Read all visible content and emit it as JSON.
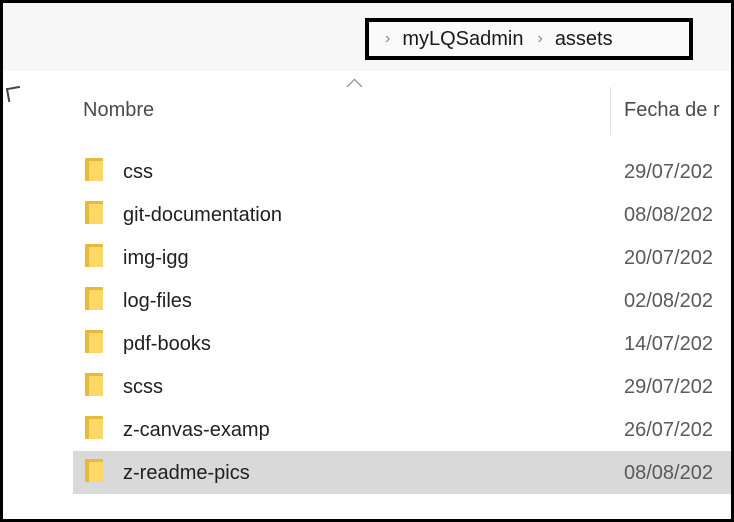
{
  "breadcrumb": {
    "items": [
      "myLQSadmin",
      "assets"
    ]
  },
  "columns": {
    "name": "Nombre",
    "date": "Fecha de r"
  },
  "rows": [
    {
      "name": "css",
      "date": "29/07/202",
      "selected": false
    },
    {
      "name": "git-documentation",
      "date": "08/08/202",
      "selected": false
    },
    {
      "name": "img-igg",
      "date": "20/07/202",
      "selected": false
    },
    {
      "name": "log-files",
      "date": "02/08/202",
      "selected": false
    },
    {
      "name": "pdf-books",
      "date": "14/07/202",
      "selected": false
    },
    {
      "name": "scss",
      "date": "29/07/202",
      "selected": false
    },
    {
      "name": "z-canvas-examp",
      "date": "26/07/202",
      "selected": false
    },
    {
      "name": "z-readme-pics",
      "date": "08/08/202",
      "selected": true
    }
  ],
  "colors": {
    "folder_back": "#e7b93a",
    "folder_front": "#ffd766",
    "selection": "#d9d9d9",
    "highlight_border": "#000000"
  },
  "icons": {
    "row": "folder-icon",
    "separator": "chevron-right-icon",
    "sort": "sort-ascending-icon"
  }
}
